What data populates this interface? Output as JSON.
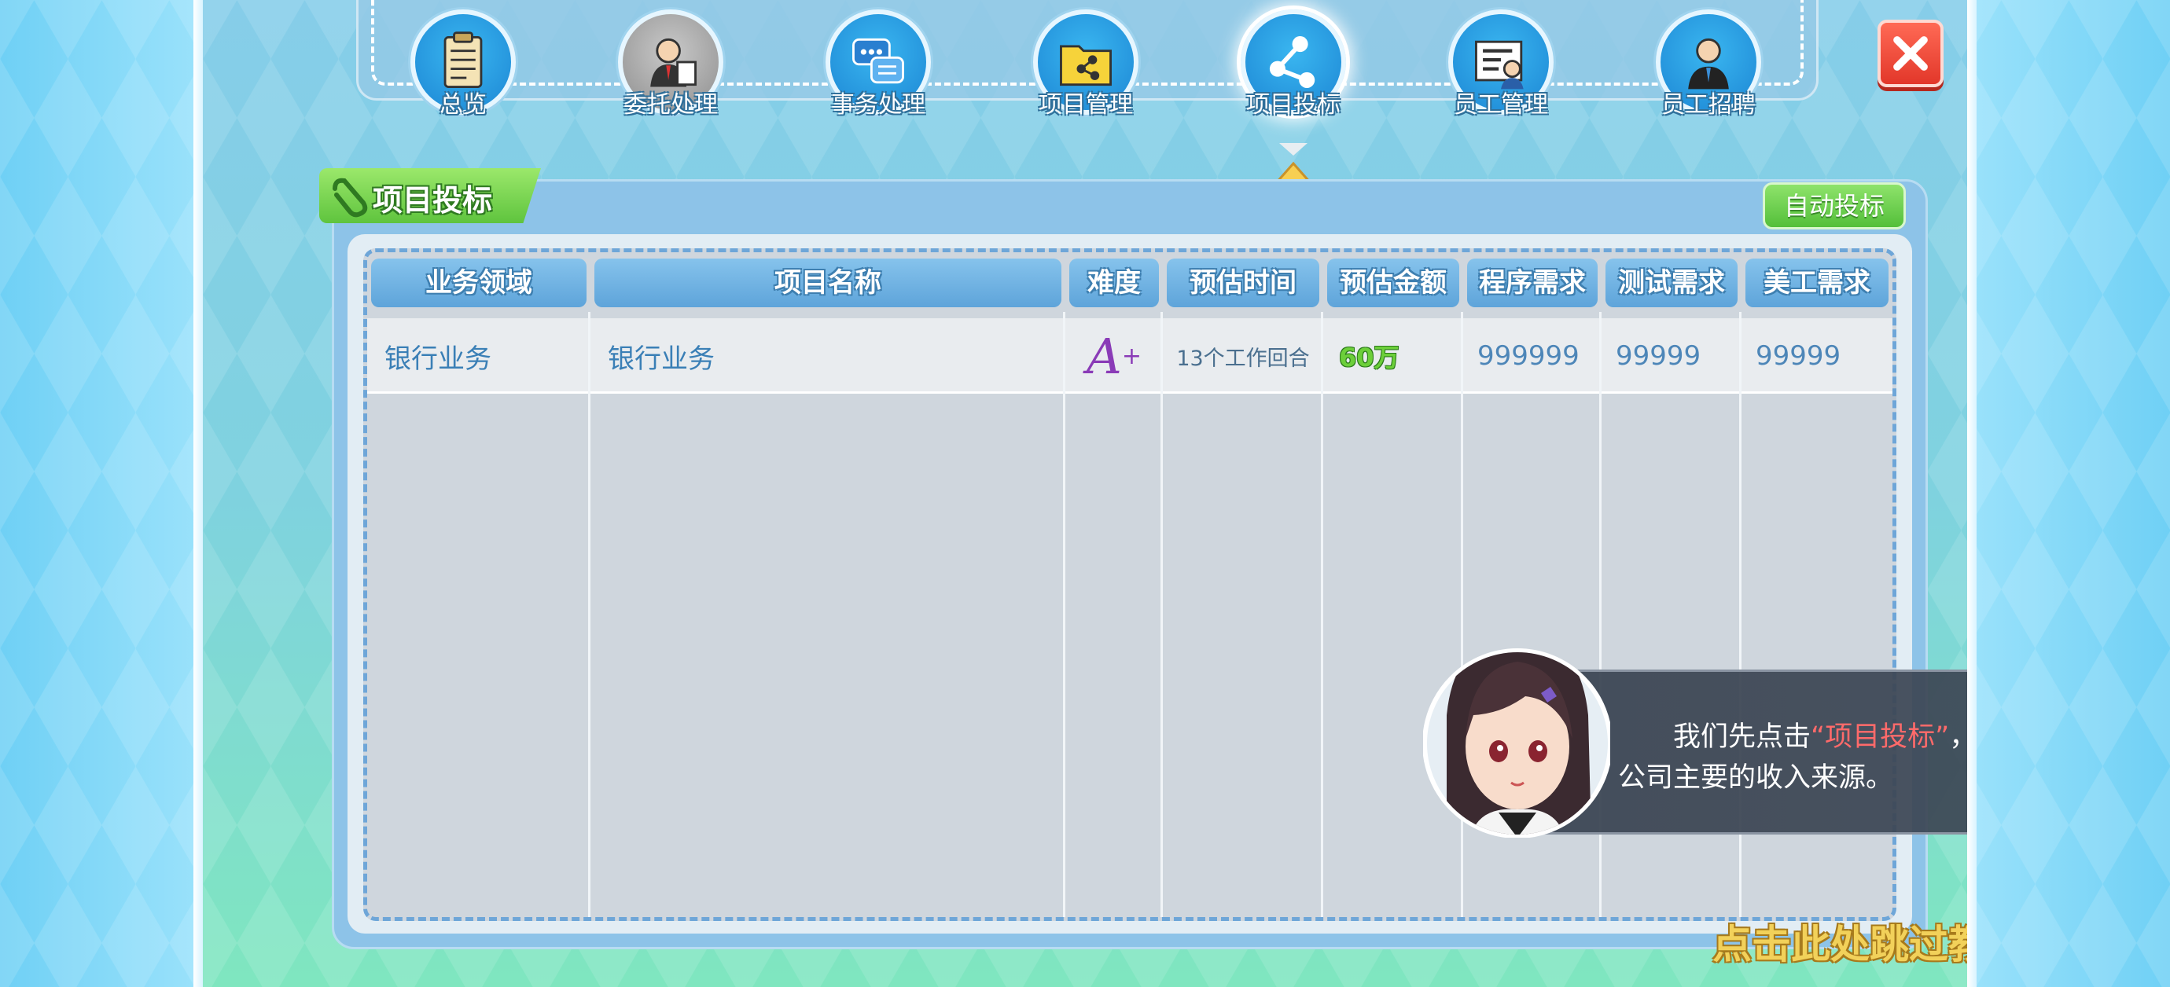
{
  "nav": {
    "items": [
      {
        "label": "总览",
        "icon": "clipboard-icon"
      },
      {
        "label": "委托处理",
        "icon": "businessman-icon"
      },
      {
        "label": "事务处理",
        "icon": "chat-bubbles-icon"
      },
      {
        "label": "项目管理",
        "icon": "folder-share-icon"
      },
      {
        "label": "项目投标",
        "icon": "share-nodes-icon",
        "active": true
      },
      {
        "label": "员工管理",
        "icon": "employee-card-icon"
      },
      {
        "label": "员工招聘",
        "icon": "recruit-icon"
      }
    ],
    "close_icon": "close-icon"
  },
  "panel": {
    "title": "项目投标",
    "auto_bid_label": "自动投标"
  },
  "table": {
    "columns": [
      "业务领域",
      "项目名称",
      "难度",
      "预估时间",
      "预估金额",
      "程序需求",
      "测试需求",
      "美工需求"
    ],
    "rows": [
      {
        "domain": "银行业务",
        "name": "银行业务",
        "difficulty": "A",
        "difficulty_suffix": "+",
        "time": "13个工作回合",
        "amount": "60万",
        "program": "999999",
        "test": "99999",
        "art": "99999"
      }
    ]
  },
  "dialog": {
    "line1_before": "我们先点击",
    "line1_highlight": "“项目投标”",
    "line1_after": "，做项目是",
    "line2": "公司主要的收入来源。"
  },
  "skip_label": "点击此处跳过教程",
  "colors": {
    "accent_blue": "#5ea4da",
    "green": "#5fc43e",
    "highlight_red": "#ff6a6a",
    "skip_gold": "#f2d15a"
  }
}
